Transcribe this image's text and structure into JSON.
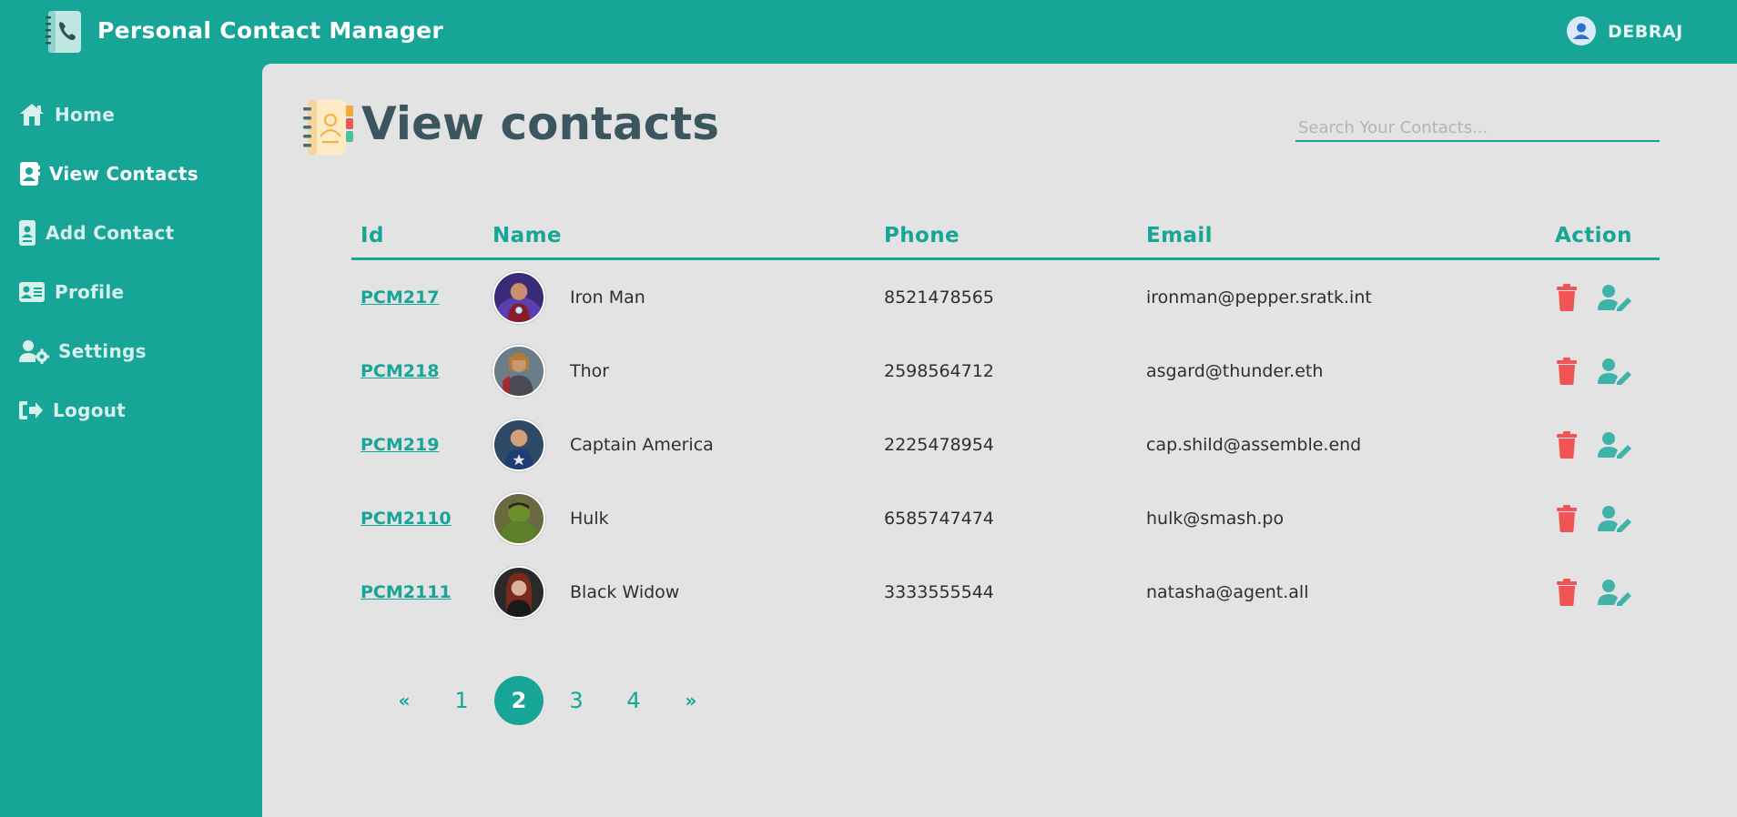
{
  "app": {
    "title": "Personal Contact Manager",
    "user_name": "DEBRAJ"
  },
  "colors": {
    "primary": "#17a597",
    "panel": "#e3e3e3",
    "title": "#3c5660",
    "delete": "#f05454"
  },
  "sidebar": {
    "items": [
      {
        "label": "Home",
        "icon": "home-icon"
      },
      {
        "label": "View Contacts",
        "icon": "contact-book-icon",
        "active": true
      },
      {
        "label": "Add Contact",
        "icon": "add-contact-icon"
      },
      {
        "label": "Profile",
        "icon": "id-card-icon"
      },
      {
        "label": "Settings",
        "icon": "user-gear-icon"
      },
      {
        "label": "Logout",
        "icon": "logout-icon"
      }
    ]
  },
  "main": {
    "title": "View contacts",
    "search_placeholder": "Search Your Contacts...",
    "columns": [
      "Id",
      "Name",
      "Phone",
      "Email",
      "Action"
    ],
    "rows": [
      {
        "id": "PCM217",
        "name": "Iron Man",
        "phone": "8521478565",
        "email": "ironman@pepper.sratk.int"
      },
      {
        "id": "PCM218",
        "name": "Thor",
        "phone": "2598564712",
        "email": "asgard@thunder.eth"
      },
      {
        "id": "PCM219",
        "name": "Captain America",
        "phone": "2225478954",
        "email": "cap.shild@assemble.end"
      },
      {
        "id": "PCM2110",
        "name": "Hulk",
        "phone": "6585747474",
        "email": "hulk@smash.po"
      },
      {
        "id": "PCM2111",
        "name": "Black Widow",
        "phone": "3333555544",
        "email": "natasha@agent.all"
      }
    ]
  },
  "pagination": {
    "prev": "«",
    "pages": [
      "1",
      "2",
      "3",
      "4"
    ],
    "current": "2",
    "next": "»"
  }
}
